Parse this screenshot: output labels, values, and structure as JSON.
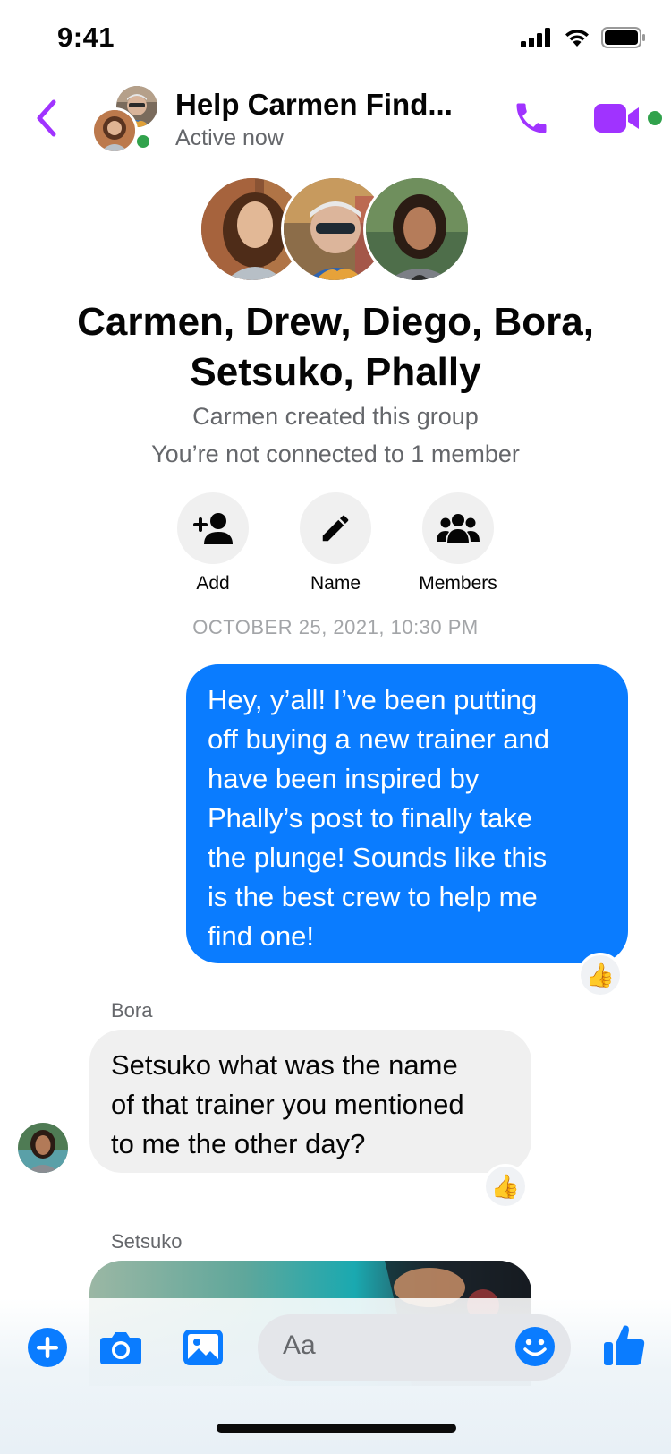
{
  "status_bar": {
    "time": "9:41",
    "icons": [
      "cellular-signal-icon",
      "wifi-icon",
      "battery-icon"
    ]
  },
  "header": {
    "title": "Help Carmen Find...",
    "status": "Active now",
    "accent_color": "#a033ff",
    "online_color": "#31a24c"
  },
  "group": {
    "name_line1": "Carmen, Drew, Diego, Bora,",
    "name_line2": "Setsuko, Phally",
    "created_text": "Carmen created this group",
    "connected_text": "You’re not connected to 1 member"
  },
  "actions": [
    {
      "label": "Add",
      "icon": "add-person-icon"
    },
    {
      "label": "Name",
      "icon": "pencil-icon"
    },
    {
      "label": "Members",
      "icon": "members-icon"
    }
  ],
  "messages": {
    "timestamp": "OCTOBER 25, 2021, 10:30 PM",
    "outgoing": {
      "lines": [
        "Hey, y’all! I’ve been putting",
        "off buying a new trainer and",
        "have been inspired by",
        "Phally’s post to finally take",
        "the plunge! Sounds like this",
        "is the best crew to help me",
        "find one!"
      ],
      "reaction": "👍",
      "bubble_color": "#0a7cff"
    },
    "incoming": {
      "sender": "Bora",
      "lines": [
        "Setsuko what was the name",
        "of that trainer you mentioned",
        "to me the other day?"
      ],
      "reaction": "👍"
    },
    "next_sender": "Setsuko"
  },
  "composer": {
    "placeholder": "Aa",
    "accent_color": "#0a7cff"
  }
}
